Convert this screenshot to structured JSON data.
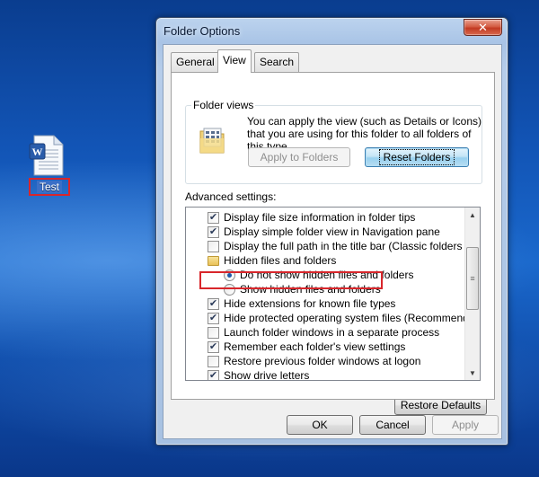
{
  "desktop": {
    "icon_label": "Test"
  },
  "window": {
    "title": "Folder Options",
    "close_glyph": "✕"
  },
  "tabs": [
    {
      "label": "General"
    },
    {
      "label": "View"
    },
    {
      "label": "Search"
    }
  ],
  "active_tab": "View",
  "folder_views": {
    "legend": "Folder views",
    "description": "You can apply the view (such as Details or Icons) that you are using for this folder to all folders of this type.",
    "apply_button": "Apply to Folders",
    "reset_button": "Reset Folders"
  },
  "advanced": {
    "label": "Advanced settings:",
    "items": [
      {
        "label": "Display file size information in folder tips",
        "type": "checkbox",
        "checked": true
      },
      {
        "label": "Display simple folder view in Navigation pane",
        "type": "checkbox",
        "checked": true
      },
      {
        "label": "Display the full path in the title bar (Classic folders only)",
        "type": "checkbox",
        "checked": false
      },
      {
        "label": "Hidden files and folders",
        "type": "folder"
      },
      {
        "label": "Do not show hidden files and folders",
        "type": "radio",
        "checked": true
      },
      {
        "label": "Show hidden files and folders",
        "type": "radio",
        "checked": false
      },
      {
        "label": "Hide extensions for known file types",
        "type": "checkbox",
        "checked": true
      },
      {
        "label": "Hide protected operating system files (Recommended)",
        "type": "checkbox",
        "checked": true
      },
      {
        "label": "Launch folder windows in a separate process",
        "type": "checkbox",
        "checked": false
      },
      {
        "label": "Remember each folder's view settings",
        "type": "checkbox",
        "checked": true
      },
      {
        "label": "Restore previous folder windows at logon",
        "type": "checkbox",
        "checked": false
      },
      {
        "label": "Show drive letters",
        "type": "checkbox",
        "checked": true
      }
    ],
    "restore_defaults": "Restore Defaults"
  },
  "footer": {
    "ok": "OK",
    "cancel": "Cancel",
    "apply": "Apply"
  },
  "glyphs": {
    "check": "✔",
    "arrow_up": "▲",
    "arrow_down": "▼",
    "thumb_grip": "≡"
  },
  "colors": {
    "highlight": "#d8262b",
    "desktop_blue": "#1a68cc"
  }
}
